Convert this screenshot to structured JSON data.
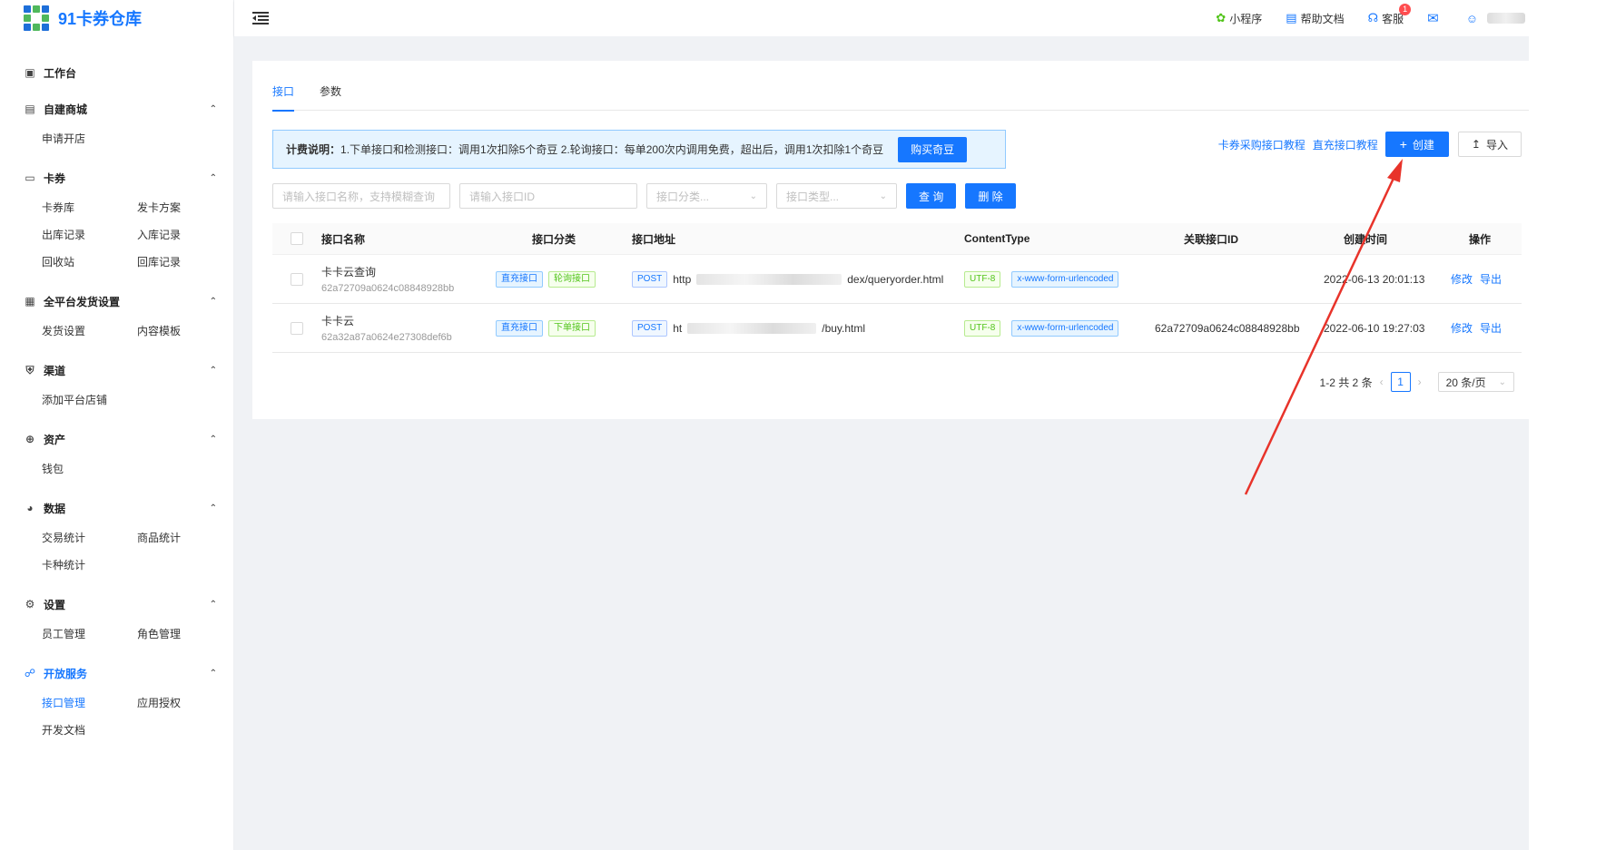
{
  "app": {
    "logo_text": "91卡券仓库"
  },
  "header": {
    "items": [
      {
        "label": "小程序",
        "icon": "mini-program-icon"
      },
      {
        "label": "帮助文档",
        "icon": "document-icon"
      },
      {
        "label": "客服",
        "icon": "headset-icon",
        "badge": "1"
      },
      {
        "label": "",
        "icon": "mail-icon"
      },
      {
        "label": "",
        "icon": "user-icon"
      }
    ]
  },
  "sidebar": {
    "groups": [
      {
        "label": "工作台",
        "icon": "dashboard-icon",
        "items": []
      },
      {
        "label": "自建商城",
        "icon": "store-icon",
        "items": [
          "申请开店"
        ]
      },
      {
        "label": "卡券",
        "icon": "card-icon",
        "items": [
          "卡券库",
          "发卡方案",
          "出库记录",
          "入库记录",
          "回收站",
          "回库记录"
        ]
      },
      {
        "label": "全平台发货设置",
        "icon": "grid-icon",
        "items": [
          "发货设置",
          "内容模板"
        ]
      },
      {
        "label": "渠道",
        "icon": "bag-icon",
        "items": [
          "添加平台店铺"
        ]
      },
      {
        "label": "资产",
        "icon": "asset-icon",
        "items": [
          "钱包"
        ]
      },
      {
        "label": "数据",
        "icon": "pie-icon",
        "items": [
          "交易统计",
          "商品统计",
          "卡种统计"
        ]
      },
      {
        "label": "设置",
        "icon": "settings-icon",
        "items": [
          "员工管理",
          "角色管理"
        ]
      },
      {
        "label": "开放服务",
        "icon": "link-icon",
        "items": [
          "接口管理",
          "应用授权",
          "开发文档"
        ],
        "active": true
      }
    ]
  },
  "tabs": [
    "接口",
    "参数"
  ],
  "notice": {
    "title": "计费说明：",
    "text": "1.下单接口和检测接口：调用1次扣除5个奇豆 2.轮询接口：每单200次内调用免费，超出后，调用1次扣除1个奇豆",
    "button": "购买奇豆"
  },
  "top_actions": {
    "link1": "卡券采购接口教程",
    "link2": "直充接口教程",
    "create": "创建",
    "import": "导入"
  },
  "filters": {
    "name_placeholder": "请输入接口名称，支持模糊查询",
    "id_placeholder": "请输入接口ID",
    "category_placeholder": "接口分类...",
    "type_placeholder": "接口类型...",
    "query": "查 询",
    "delete": "删 除"
  },
  "table": {
    "columns": [
      "接口名称",
      "接口分类",
      "接口地址",
      "ContentType",
      "关联接口ID",
      "创建时间",
      "操作"
    ],
    "rows": [
      {
        "name": "卡卡云查询",
        "id": "62a72709a0624c08848928bb",
        "tags": [
          {
            "text": "直充接口",
            "color": "blue"
          },
          {
            "text": "轮询接口",
            "color": "green"
          }
        ],
        "method": "POST",
        "url_prefix": "http",
        "url_suffix": "dex/queryorder.html",
        "charset": "UTF-8",
        "content_type": "x-www-form-urlencoded",
        "related_id": "",
        "created": "2022-06-13 20:01:13",
        "edit": "修改",
        "export": "导出"
      },
      {
        "name": "卡卡云",
        "id": "62a32a87a0624e27308def6b",
        "tags": [
          {
            "text": "直充接口",
            "color": "blue"
          },
          {
            "text": "下单接口",
            "color": "green"
          }
        ],
        "method": "POST",
        "url_prefix": "ht",
        "url_suffix": "/buy.html",
        "charset": "UTF-8",
        "content_type": "x-www-form-urlencoded",
        "related_id": "62a72709a0624c08848928bb",
        "created": "2022-06-10 19:27:03",
        "edit": "修改",
        "export": "导出"
      }
    ]
  },
  "pagination": {
    "summary": "1-2 共 2 条",
    "current": "1",
    "page_size": "20 条/页"
  },
  "colors": {
    "primary": "#1677ff",
    "annotation": "#e8332a"
  }
}
